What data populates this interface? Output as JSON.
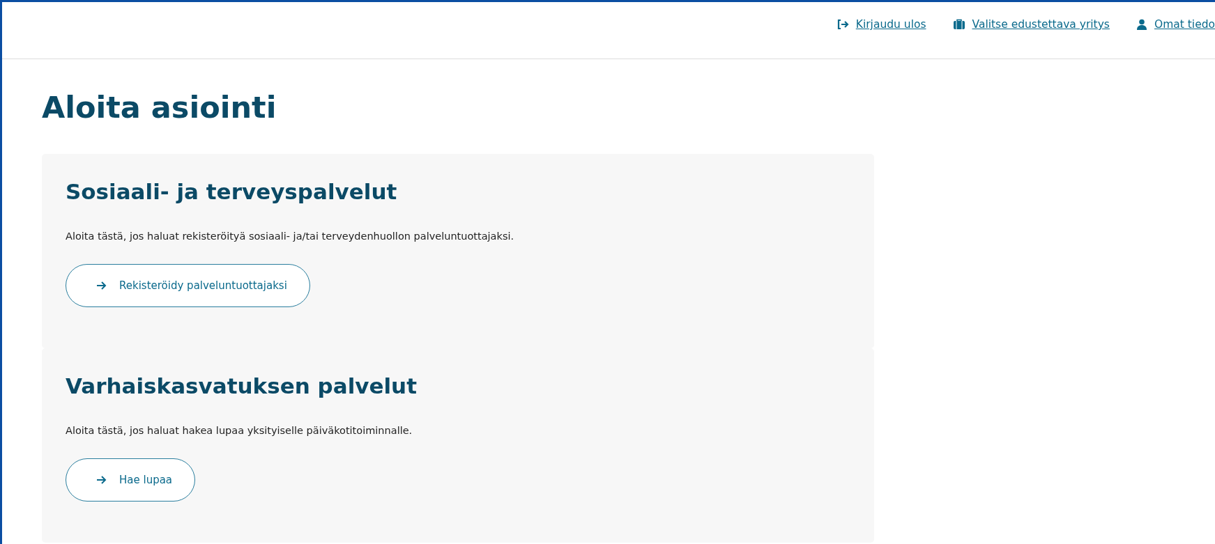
{
  "header_links": [
    {
      "kind": "logout",
      "label": "Kirjaudu ulos"
    },
    {
      "kind": "company",
      "label": "Valitse edustettava yritys"
    },
    {
      "kind": "user",
      "label": "Omat tiedo"
    }
  ],
  "page_title": "Aloita asiointi",
  "cards": [
    {
      "title": "Sosiaali- ja terveyspalvelut",
      "text": "Aloita tästä, jos haluat rekisteröityä sosiaali- ja/tai terveydenhuollon palveluntuottajaksi.",
      "button": "Rekisteröidy palveluntuottajaksi"
    },
    {
      "title": "Varhaiskasvatuksen palvelut",
      "text": "Aloita tästä, jos haluat hakea lupaa yksityiselle päiväkotitoiminnalle.",
      "button": "Hae lupaa"
    }
  ]
}
